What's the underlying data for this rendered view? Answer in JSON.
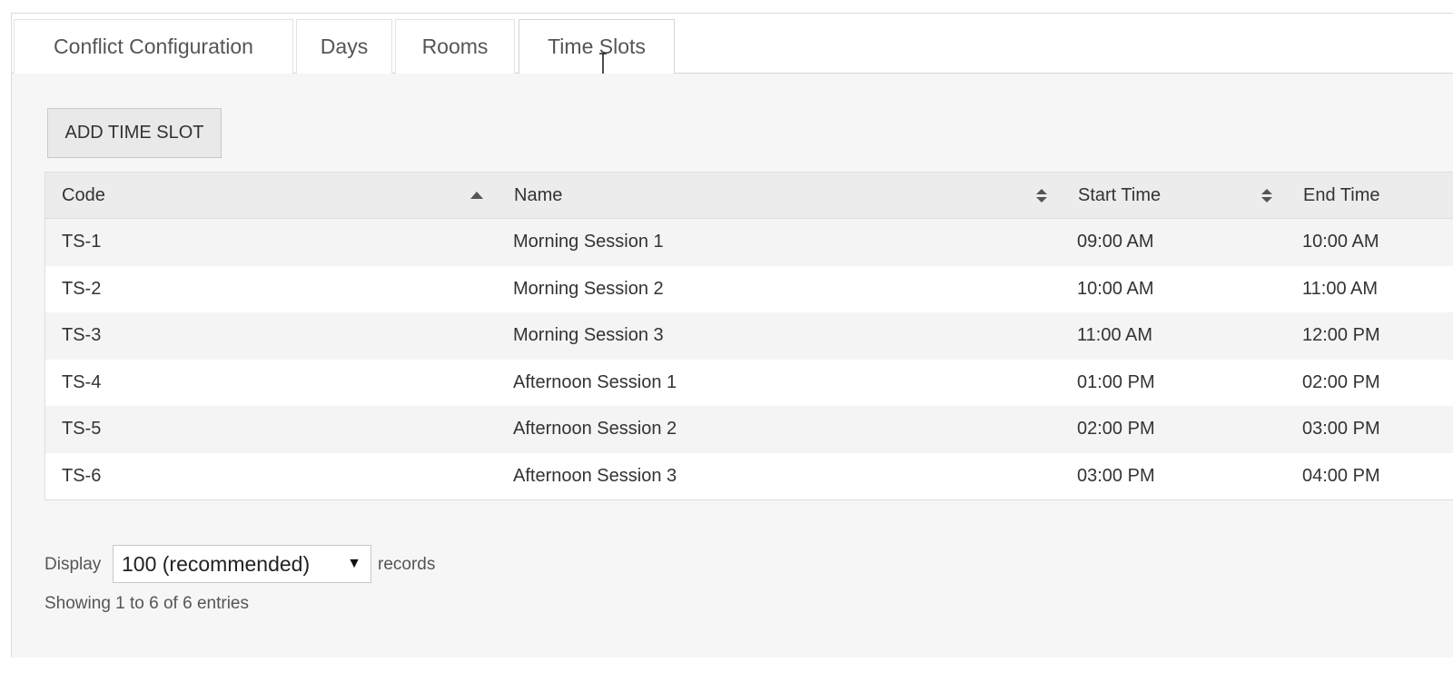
{
  "tabs": [
    {
      "label": "Conflict Configuration",
      "active": false
    },
    {
      "label": "Days",
      "active": false
    },
    {
      "label": "Rooms",
      "active": false
    },
    {
      "label": "Time Slots",
      "active": true
    }
  ],
  "toolbar": {
    "add_label": "ADD TIME SLOT"
  },
  "table": {
    "columns": [
      {
        "label": "Code",
        "sort": "ascending"
      },
      {
        "label": "Name",
        "sort": "sortable"
      },
      {
        "label": "Start Time",
        "sort": "sortable"
      },
      {
        "label": "End Time",
        "sort": "none"
      }
    ],
    "rows": [
      {
        "code": "TS-1",
        "name": "Morning Session 1",
        "start": "09:00 AM",
        "end": "10:00 AM"
      },
      {
        "code": "TS-2",
        "name": "Morning Session 2",
        "start": "10:00 AM",
        "end": "11:00 AM"
      },
      {
        "code": "TS-3",
        "name": "Morning Session 3",
        "start": "11:00 AM",
        "end": "12:00 PM"
      },
      {
        "code": "TS-4",
        "name": "Afternoon Session 1",
        "start": "01:00 PM",
        "end": "02:00 PM"
      },
      {
        "code": "TS-5",
        "name": "Afternoon Session 2",
        "start": "02:00 PM",
        "end": "03:00 PM"
      },
      {
        "code": "TS-6",
        "name": "Afternoon Session 3",
        "start": "03:00 PM",
        "end": "04:00 PM"
      }
    ]
  },
  "footer": {
    "display_label": "Display",
    "page_size_value": "100 (recommended)",
    "records_label": "records",
    "showing_text": "Showing 1 to 6 of 6 entries"
  },
  "icons": {
    "sort_asc": "sort-ascending-icon",
    "sort_both": "sort-both-icon",
    "select_arrow": "caret-down-icon",
    "cursor": "text-cursor-icon"
  }
}
